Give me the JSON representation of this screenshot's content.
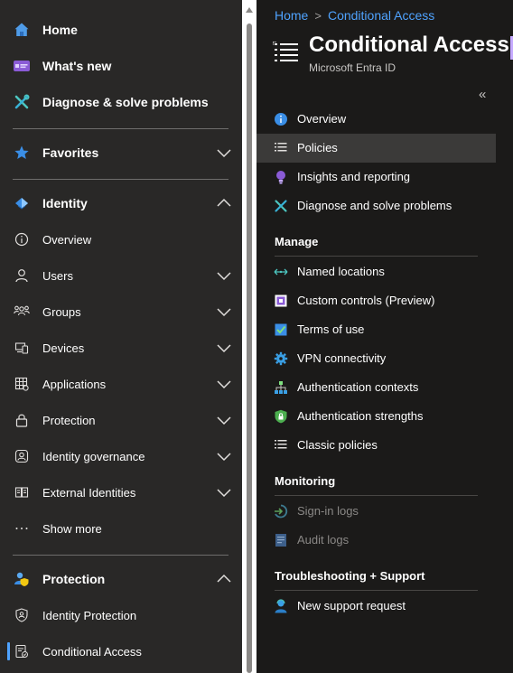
{
  "left_nav": {
    "top_items": [
      {
        "label": "Home",
        "icon": "home-icon"
      },
      {
        "label": "What's new",
        "icon": "whats-new-icon"
      },
      {
        "label": "Diagnose & solve problems",
        "icon": "wrench-icon"
      }
    ],
    "favorites": {
      "label": "Favorites",
      "icon": "star-icon"
    },
    "identity": {
      "label": "Identity",
      "icon": "identity-icon",
      "items": [
        {
          "label": "Overview",
          "icon": "info-icon",
          "expandable": false
        },
        {
          "label": "Users",
          "icon": "user-icon",
          "expandable": true
        },
        {
          "label": "Groups",
          "icon": "groups-icon",
          "expandable": true
        },
        {
          "label": "Devices",
          "icon": "devices-icon",
          "expandable": true
        },
        {
          "label": "Applications",
          "icon": "applications-icon",
          "expandable": true
        },
        {
          "label": "Protection",
          "icon": "lock-icon",
          "expandable": true
        },
        {
          "label": "Identity governance",
          "icon": "governance-icon",
          "expandable": true
        },
        {
          "label": "External Identities",
          "icon": "external-identities-icon",
          "expandable": true
        },
        {
          "label": "Show more",
          "icon": "ellipsis-icon",
          "expandable": false
        }
      ]
    },
    "protection": {
      "label": "Protection",
      "icon": "protection-icon",
      "items": [
        {
          "label": "Identity Protection",
          "icon": "shield-icon"
        },
        {
          "label": "Conditional Access",
          "icon": "conditional-access-icon",
          "selected": true
        }
      ]
    }
  },
  "breadcrumb": {
    "items": [
      "Home",
      "Conditional Access"
    ],
    "separator": ">"
  },
  "header": {
    "title": "Conditional Access |",
    "subtitle": "Microsoft Entra ID"
  },
  "menu": {
    "collapse_glyph": "«",
    "top": [
      {
        "label": "Overview",
        "icon": "info-icon"
      },
      {
        "label": "Policies",
        "icon": "list-icon",
        "selected": true
      },
      {
        "label": "Insights and reporting",
        "icon": "lightbulb-icon"
      },
      {
        "label": "Diagnose and solve problems",
        "icon": "wrench-icon"
      }
    ],
    "sections": [
      {
        "title": "Manage",
        "items": [
          {
            "label": "Named locations",
            "icon": "arrows-icon"
          },
          {
            "label": "Custom controls (Preview)",
            "icon": "custom-controls-icon"
          },
          {
            "label": "Terms of use",
            "icon": "checklist-icon"
          },
          {
            "label": "VPN connectivity",
            "icon": "gear-icon"
          },
          {
            "label": "Authentication contexts",
            "icon": "hierarchy-icon"
          },
          {
            "label": "Authentication strengths",
            "icon": "shield-lock-icon"
          },
          {
            "label": "Classic policies",
            "icon": "list-icon"
          }
        ]
      },
      {
        "title": "Monitoring",
        "items": [
          {
            "label": "Sign-in logs",
            "icon": "sign-in-icon",
            "disabled": true
          },
          {
            "label": "Audit logs",
            "icon": "audit-log-icon",
            "disabled": true
          }
        ]
      },
      {
        "title": "Troubleshooting + Support",
        "items": [
          {
            "label": "New support request",
            "icon": "support-person-icon"
          }
        ]
      }
    ]
  },
  "colors": {
    "accent": "#4fa3ff",
    "nav_bg": "#292827",
    "content_bg": "#1b1a19",
    "selected_bg": "#3b3a39"
  }
}
